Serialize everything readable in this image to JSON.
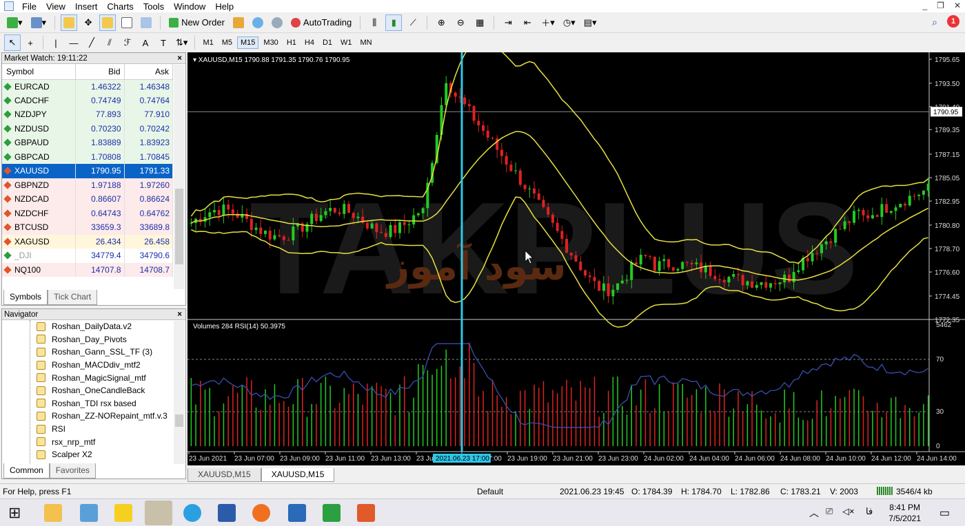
{
  "menu": [
    "File",
    "View",
    "Insert",
    "Charts",
    "Tools",
    "Window",
    "Help"
  ],
  "toolbar": {
    "new_order": "New Order",
    "autotrading": "AutoTrading",
    "notifications": "1"
  },
  "timeframes": [
    "M1",
    "M5",
    "M15",
    "M30",
    "H1",
    "H4",
    "D1",
    "W1",
    "MN"
  ],
  "active_timeframe": "M15",
  "market_watch": {
    "title": "Market Watch: 19:11:22",
    "columns": [
      "Symbol",
      "Bid",
      "Ask"
    ],
    "rows": [
      {
        "symbol": "EURCAD",
        "bid": "1.46322",
        "ask": "1.46348",
        "bg": "#e8f6e8",
        "dir": "up"
      },
      {
        "symbol": "CADCHF",
        "bid": "0.74749",
        "ask": "0.74764",
        "bg": "#e8f6e8",
        "dir": "up"
      },
      {
        "symbol": "NZDJPY",
        "bid": "77.893",
        "ask": "77.910",
        "bg": "#e8f6e8",
        "dir": "up"
      },
      {
        "symbol": "NZDUSD",
        "bid": "0.70230",
        "ask": "0.70242",
        "bg": "#e8f6e8",
        "dir": "up"
      },
      {
        "symbol": "GBPAUD",
        "bid": "1.83889",
        "ask": "1.83923",
        "bg": "#e8f6e8",
        "dir": "up"
      },
      {
        "symbol": "GBPCAD",
        "bid": "1.70808",
        "ask": "1.70845",
        "bg": "#e8f6e8",
        "dir": "up"
      },
      {
        "symbol": "XAUUSD",
        "bid": "1790.95",
        "ask": "1791.33",
        "bg": "#0a64c8",
        "dir": "down"
      },
      {
        "symbol": "GBPNZD",
        "bid": "1.97188",
        "ask": "1.97260",
        "bg": "#fdeaea",
        "dir": "down"
      },
      {
        "symbol": "NZDCAD",
        "bid": "0.86607",
        "ask": "0.86624",
        "bg": "#fdeaea",
        "dir": "down"
      },
      {
        "symbol": "NZDCHF",
        "bid": "0.64743",
        "ask": "0.64762",
        "bg": "#fdeaea",
        "dir": "down"
      },
      {
        "symbol": "BTCUSD",
        "bid": "33659.3",
        "ask": "33689.8",
        "bg": "#fdeaea",
        "dir": "down"
      },
      {
        "symbol": "XAGUSD",
        "bid": "26.434",
        "ask": "26.458",
        "bg": "#fff6dc",
        "dir": "down"
      },
      {
        "symbol": "_DJI",
        "bid": "34779.4",
        "ask": "34790.6",
        "bg": "#ffffff",
        "dir": "up"
      },
      {
        "symbol": "NQ100",
        "bid": "14707.8",
        "ask": "14708.7",
        "bg": "#fdeaea",
        "dir": "down"
      }
    ],
    "tabs": [
      "Symbols",
      "Tick Chart"
    ]
  },
  "navigator": {
    "title": "Navigator",
    "items": [
      "Roshan_DailyData.v2",
      "Roshan_Day_Pivots",
      "Roshan_Gann_SSL_TF (3)",
      "Roshan_MACDdiv_mtf2",
      "Roshan_MagicSignal_mtf",
      "Roshan_OneCandleBack",
      "Roshan_TDI rsx based",
      "Roshan_ZZ-NORepaint_mtf.v.3",
      "RSI",
      "rsx_nrp_mtf",
      "Scalper X2"
    ],
    "tabs": [
      "Common",
      "Favorites"
    ]
  },
  "chart": {
    "header": "XAUUSD,M15  1790.88 1791.35 1790.76 1790.95",
    "sub_header": "Volumes 284  RSI(14) 50.3975",
    "price_labels": [
      "1795.65",
      "1793.50",
      "1791.40",
      "1789.35",
      "1787.15",
      "1785.05",
      "1782.95",
      "1780.80",
      "1778.70",
      "1776.60",
      "1774.45",
      "1772.35"
    ],
    "current_price": "1790.95",
    "sub_labels": [
      "5462",
      "70",
      "30",
      "0"
    ],
    "time_labels": [
      "23 Jun 2021",
      "23 Jun 07:00",
      "23 Jun 09:00",
      "23 Jun 11:00",
      "23 Jun 13:00",
      "23 Jun 15:00",
      "23 Jun 17:00",
      "23 Jun 19:00",
      "23 Jun 21:00",
      "23 Jun 23:00",
      "24 Jun 02:00",
      "24 Jun 04:00",
      "24 Jun 06:00",
      "24 Jun 08:00",
      "24 Jun 10:00",
      "24 Jun 12:00",
      "24 Jun 14:00"
    ],
    "crosshair_label": "2021.06.23 17:00",
    "watermark": "TAKPLUS",
    "watermark2": "سود آموز",
    "colors": {
      "up": "#22cc22",
      "down": "#dd2222",
      "band": "#e8e040",
      "rsi": "#3a4fb0",
      "cursor": "#2ec8e8"
    }
  },
  "chart_tabs": [
    "XAUUSD,M15",
    "XAUUSD,M15"
  ],
  "status": {
    "help": "For Help, press F1",
    "profile": "Default",
    "datetime": "2021.06.23 19:45",
    "open": "O: 1784.39",
    "high": "H: 1784.70",
    "low": "L: 1782.86",
    "close": "C: 1783.21",
    "volume": "V: 2003",
    "traffic": "3546/4 kb"
  },
  "taskbar": {
    "time": "8:41 PM",
    "date": "7/5/2021",
    "lang": "فا"
  }
}
